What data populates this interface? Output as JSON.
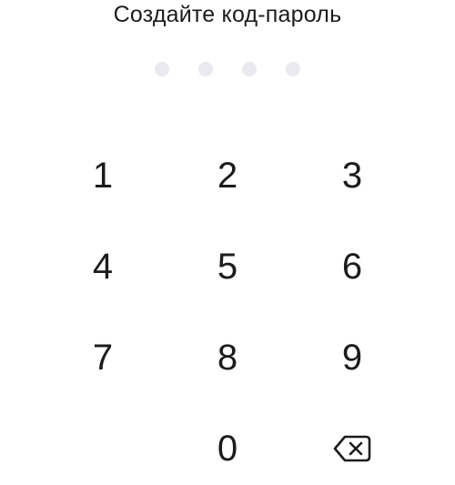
{
  "title": "Создайте код-пароль",
  "passcode": {
    "length": 4,
    "entered": 0,
    "dot_color": "#e9e9ef"
  },
  "keypad": {
    "keys": [
      "1",
      "2",
      "3",
      "4",
      "5",
      "6",
      "7",
      "8",
      "9",
      "0"
    ],
    "backspace_icon": "backspace-icon"
  },
  "colors": {
    "text": "#1c1c1e",
    "background": "#ffffff"
  }
}
